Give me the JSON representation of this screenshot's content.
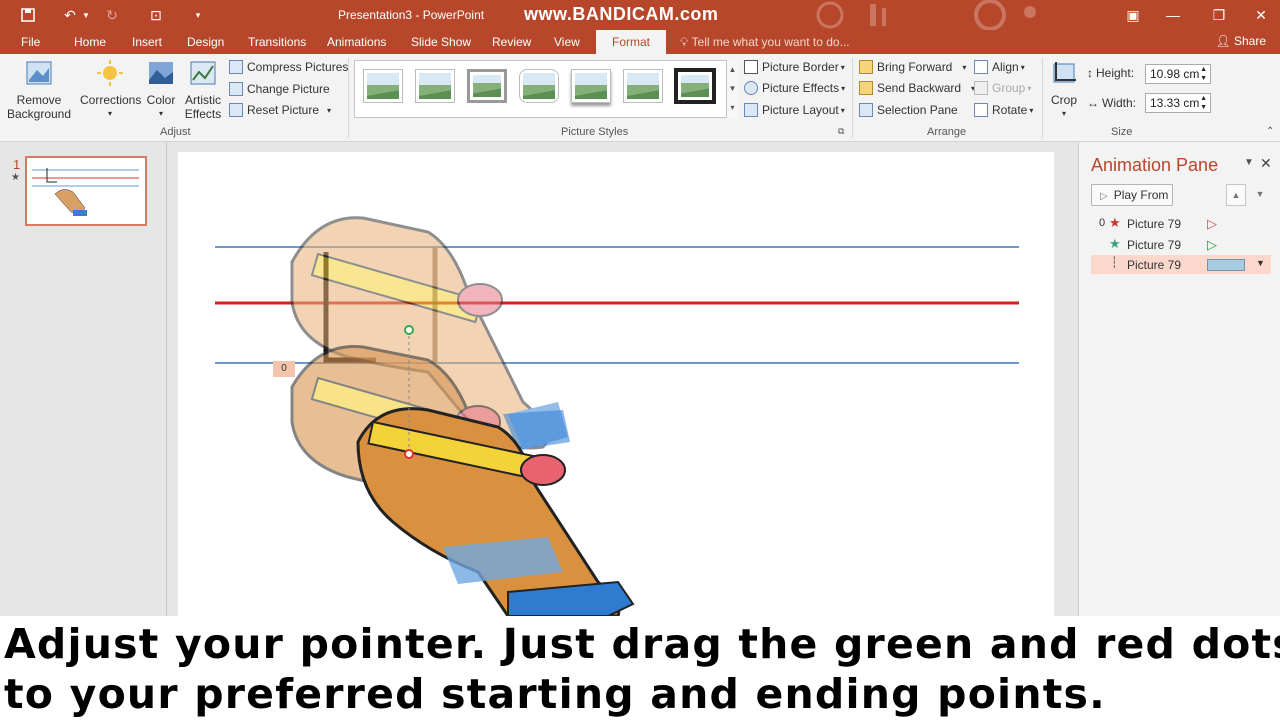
{
  "titlebar": {
    "doc_title": "Presentation3 - PowerPoint",
    "watermark": "www.BANDICAM.com",
    "brand_color": "#b7472a"
  },
  "tabs": [
    "File",
    "Home",
    "Insert",
    "Design",
    "Transitions",
    "Animations",
    "Slide Show",
    "Review",
    "View",
    "Format"
  ],
  "active_tab": "Format",
  "tell_me": "Tell me what you want to do...",
  "share": "Share",
  "ribbon": {
    "remove_background": "Remove Background",
    "corrections": "Corrections",
    "color": "Color",
    "artistic_effects": "Artistic Effects",
    "compress": "Compress Pictures",
    "change": "Change Picture",
    "reset": "Reset Picture",
    "adjust_label": "Adjust",
    "picture_styles_label": "Picture Styles",
    "picture_border": "Picture Border",
    "picture_effects": "Picture Effects",
    "picture_layout": "Picture Layout",
    "bring_forward": "Bring Forward",
    "send_backward": "Send Backward",
    "selection_pane": "Selection Pane",
    "align": "Align",
    "group": "Group",
    "rotate": "Rotate",
    "arrange_label": "Arrange",
    "crop": "Crop",
    "height_label": "Height:",
    "height_value": "10.98 cm",
    "width_label": "Width:",
    "width_value": "13.33 cm",
    "size_label": "Size"
  },
  "slides": {
    "current_number": "1"
  },
  "anim_tag": "0",
  "animation_pane": {
    "title": "Animation Pane",
    "play_from": "Play From",
    "items": [
      {
        "num": "0",
        "label": "Picture 79",
        "icon": "red-star-icon"
      },
      {
        "num": "",
        "label": "Picture 79",
        "icon": "green-star-icon"
      },
      {
        "num": "",
        "label": "Picture 79",
        "icon": "motion-path-icon"
      }
    ]
  },
  "caption": {
    "line1": "Adjust your pointer. Just drag the green and red dots",
    "line2": "to your preferred starting and ending points."
  }
}
